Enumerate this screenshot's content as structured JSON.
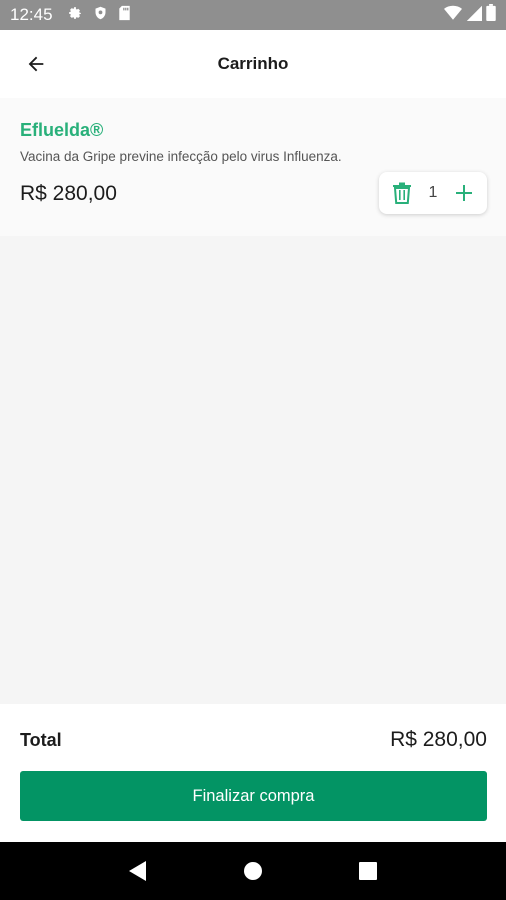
{
  "status_bar": {
    "time": "12:45",
    "icons_left": [
      "settings-icon",
      "shield-icon",
      "sd-card-icon"
    ],
    "icons_right": [
      "wifi-icon",
      "signal-icon",
      "battery-icon"
    ]
  },
  "app_bar": {
    "title": "Carrinho",
    "back_icon": "arrow-left-icon"
  },
  "cart": {
    "items": [
      {
        "name": "Efluelda®",
        "description": "Vacina da Gripe previne infecção pelo virus Influenza.",
        "price": "R$ 280,00",
        "quantity": "1"
      }
    ]
  },
  "footer": {
    "total_label": "Total",
    "total_value": "R$ 280,00",
    "checkout_label": "Finalizar compra"
  },
  "colors": {
    "accent_green": "#29b07a",
    "button_green": "#039464",
    "status_bar": "#8f8f8f"
  }
}
